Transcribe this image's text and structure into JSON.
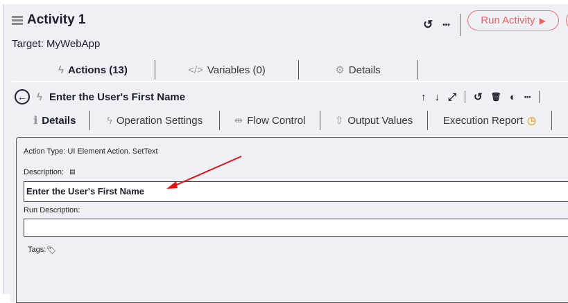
{
  "header": {
    "title": "Activity 1",
    "target": "Target: MyWebApp",
    "run_label": "Run Activity",
    "undo_icon": "↺",
    "more_icon": "•••",
    "play_icon": "▶"
  },
  "tabs": [
    {
      "label": "Actions (13)",
      "icon": "ϟ"
    },
    {
      "label": "Variables (0)",
      "icon": "</>"
    },
    {
      "label": "Details",
      "icon": "⚙"
    }
  ],
  "action": {
    "title": "Enter the User's First Name",
    "icons": [
      "↑",
      "↓",
      "⤢",
      "↺",
      "🗑",
      "◐",
      "•••"
    ]
  },
  "subtabs": [
    {
      "label": "Details",
      "icon": "ℹ"
    },
    {
      "label": "Operation Settings",
      "icon": "ϟ"
    },
    {
      "label": "Flow Control",
      "icon": "⇹"
    },
    {
      "label": "Output Values",
      "icon": "⇧"
    },
    {
      "label": "Execution Report",
      "icon": "◷"
    }
  ],
  "details": {
    "action_type": "Action Type: UI Element Action. SetText",
    "description_label": "Description:",
    "description_value": "Enter the User's First Name",
    "run_description_label": "Run Description:",
    "run_description_value": "",
    "tags_label": "Tags:"
  },
  "colors": {
    "accent": "#f06060",
    "underline": "#d03a80",
    "arrow": "#e81010",
    "clock": "#f0b030"
  }
}
